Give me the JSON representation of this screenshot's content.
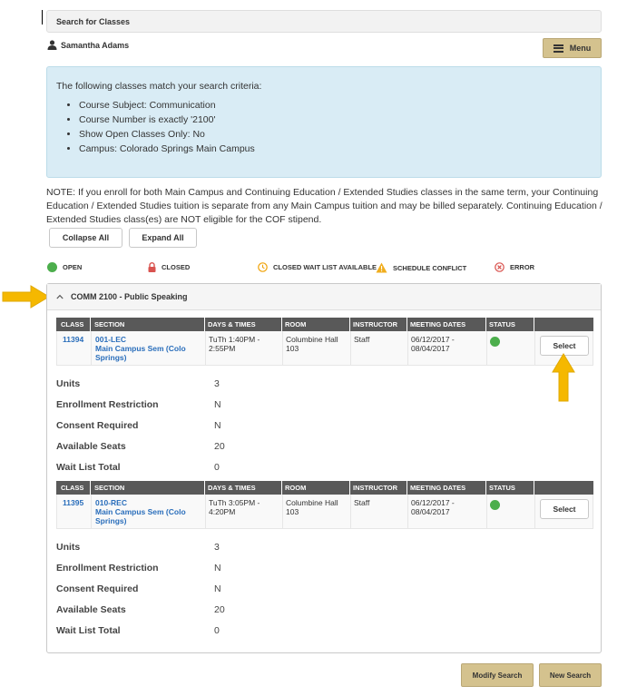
{
  "search": {
    "title": "Search for Classes"
  },
  "user": {
    "name": "Samantha Adams",
    "icon": "user-icon"
  },
  "menu": {
    "label": "Menu",
    "icon": "hamburger-icon"
  },
  "criteria": {
    "intro": "The following classes match your search criteria:",
    "items": [
      "Course Subject: Communication",
      "Course Number is exactly '2100'",
      "Show Open Classes Only: No",
      "Campus: Colorado Springs Main Campus"
    ]
  },
  "note": "NOTE: If you enroll for both Main Campus and Continuing Education / Extended Studies classes in the same term, your Continuing Education / Extended Studies tuition is separate from any Main Campus tuition and may be billed separately. Continuing Education / Extended Studies class(es) are NOT eligible for the COF stipend.",
  "buttons": {
    "collapse_all": "Collapse All",
    "expand_all": "Expand All",
    "modify_search": "Modify Search",
    "new_search": "New Search"
  },
  "legend": {
    "open": "OPEN",
    "closed": "CLOSED",
    "closed_wait": "CLOSED WAIT LIST AVAILABLE",
    "conflict": "SCHEDULE CONFLICT",
    "error": "ERROR"
  },
  "course": {
    "title": "COMM 2100 - Public Speaking"
  },
  "table_headers": [
    "CLASS",
    "SECTION",
    "DAYS & TIMES",
    "ROOM",
    "INSTRUCTOR",
    "MEETING DATES",
    "STATUS"
  ],
  "sections": [
    {
      "class": "11394",
      "section_code": "001-LEC",
      "section_name": "Main Campus Sem (Colo Springs)",
      "days_times": "TuTh 1:40PM - 2:55PM",
      "room": "Columbine Hall 103",
      "instructor": "Staff",
      "dates": "06/12/2017 - 08/04/2017",
      "status": "open",
      "select": "Select",
      "details": {
        "units": "3",
        "enrollment_restriction": "N",
        "consent_required": "N",
        "available_seats": "20",
        "wait_list_total": "0"
      }
    },
    {
      "class": "11395",
      "section_code": "010-REC",
      "section_name": "Main Campus Sem (Colo Springs)",
      "days_times": "TuTh 3:05PM - 4:20PM",
      "room": "Columbine Hall 103",
      "instructor": "Staff",
      "dates": "06/12/2017 - 08/04/2017",
      "status": "open",
      "select": "Select",
      "details": {
        "units": "3",
        "enrollment_restriction": "N",
        "consent_required": "N",
        "available_seats": "20",
        "wait_list_total": "0"
      }
    }
  ],
  "detail_labels": {
    "units": "Units",
    "enrollment_restriction": "Enrollment Restriction",
    "consent_required": "Consent Required",
    "available_seats": "Available Seats",
    "wait_list_total": "Wait List Total"
  },
  "colors": {
    "accent_gold": "#d4c28e",
    "open_green": "#4cae4c",
    "info_bg": "#d9ecf5",
    "link_blue": "#2a6ebb",
    "annotation_arrow": "#f5b800"
  }
}
